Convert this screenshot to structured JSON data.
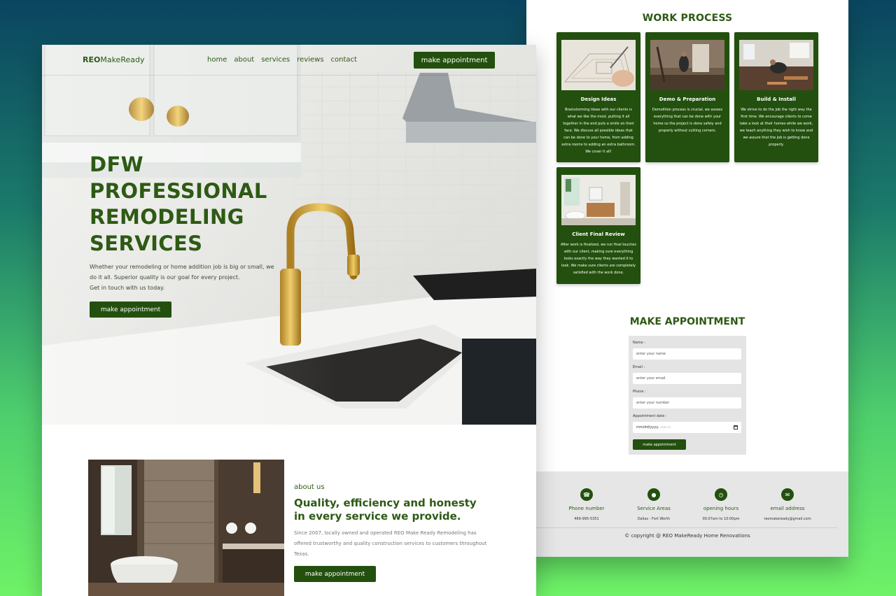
{
  "work_process": {
    "title": "WORK PROCESS",
    "cards": [
      {
        "title": "Design Ideas",
        "desc": "Brainstorming Ideas with our clients is what we like the most, putting it all together in the end puts a smile on their face. We discuss all possible ideas that can be done to your home, from adding extra rooms to adding an extra bathroom. We cover it all!"
      },
      {
        "title": "Demo & Preparation",
        "desc": "Demolition process is crucial, we assess everything that can be done with your home so the project is done safely and properly without cutting corners."
      },
      {
        "title": "Build & Install",
        "desc": "We strive to do the job the right way the first time. We encourage clients to come take a look at their homes while we work, we teach anything they wish to know and we assure that the job is getting done properly."
      },
      {
        "title": "Client Final Review",
        "desc": "After work is finalized, we run final touches with our client, making sure everything looks exactly the way they wanted it to look. We make sure clients are completely satisfied with the work done."
      }
    ]
  },
  "appointment": {
    "title": "MAKE APPOINTMENT",
    "name_label": "Name :",
    "name_placeholder": "enter your name",
    "email_label": "Email :",
    "email_placeholder": "enter your email",
    "phone_label": "Phone :",
    "phone_placeholder": "enter your number",
    "date_label": "Appointment date :",
    "date_placeholder": "mm/dd/yyyy, --:-- --",
    "submit": "make appointment"
  },
  "footer": {
    "items": [
      {
        "icon": "phone-icon",
        "label": "Phone number",
        "value": "469-995-5351"
      },
      {
        "icon": "map-pin-icon",
        "label": "Service Areas",
        "value": "Dallas - Fort Worth"
      },
      {
        "icon": "clock-icon",
        "label": "opening hours",
        "value": "00:07am to 10:00pm"
      },
      {
        "icon": "email-icon",
        "label": "email address",
        "value": "reomakeready@gmail.com"
      }
    ],
    "copyright": "© copyright @ REO MakeReady Home Renovations"
  },
  "nav": {
    "logo_bold": "REO",
    "logo_rest": "MakeReady",
    "links": [
      "home",
      "about",
      "services",
      "reviews",
      "contact"
    ],
    "cta": "make appointment"
  },
  "hero": {
    "line1": "DFW",
    "line2": "PROFESSIONAL",
    "line3": "REMODELING",
    "line4": "SERVICES",
    "p1": "Whether your remodeling or home addition job is big or small, we do it all. Superior quality is our goal for every project.",
    "p2": "Get in touch with us today.",
    "cta": "make appointment"
  },
  "about": {
    "kicker": "about us",
    "heading": "Quality, efficiency and honesty in every service we provide.",
    "body": "Since 2007, locally owned and operated REO Make Ready Remodeling has offered trustworthy and quality construction services to customers throughout Texas.",
    "cta": "make appointment"
  },
  "colors": {
    "brand_green": "#23500e",
    "heading_green": "#2d5a14"
  }
}
